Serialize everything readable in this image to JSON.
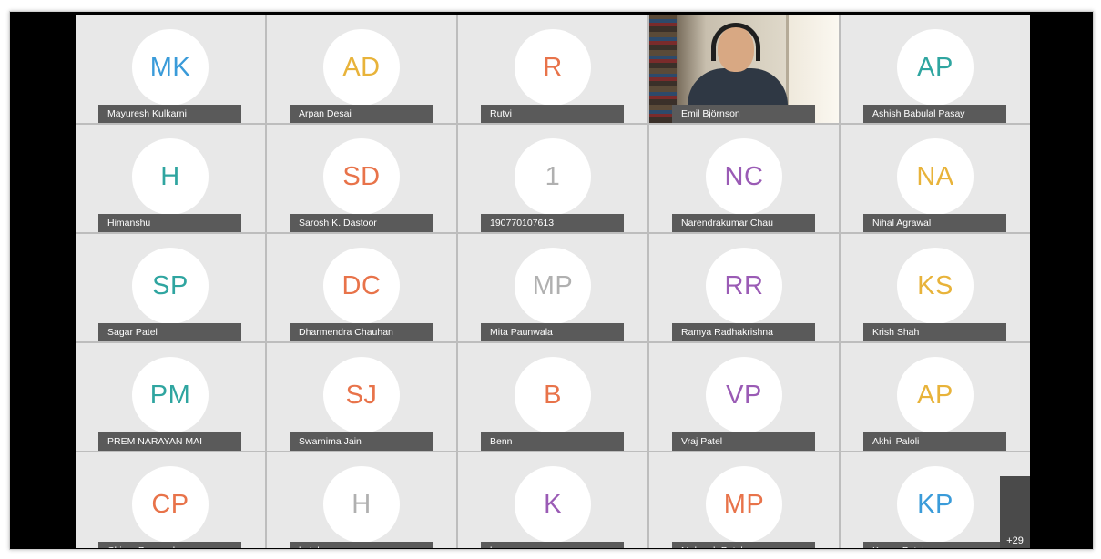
{
  "participants": [
    {
      "initials": "MK",
      "name": "Mayuresh Kulkarni",
      "color": "#3a9bd9"
    },
    {
      "initials": "AD",
      "name": "Arpan Desai",
      "color": "#e8b33a"
    },
    {
      "initials": "R",
      "name": "Rutvi",
      "color": "#e8734a"
    },
    {
      "initials": "",
      "name": "Emil Björnson",
      "color": "#ffffff",
      "video": true
    },
    {
      "initials": "AP",
      "name": "Ashish Babulal Pasay",
      "color": "#2fa5a0"
    },
    {
      "initials": "H",
      "name": "Himanshu",
      "color": "#2fa5a0"
    },
    {
      "initials": "SD",
      "name": "Sarosh K. Dastoor",
      "color": "#e8734a"
    },
    {
      "initials": "1",
      "name": "190770107613",
      "color": "#b0b0b0"
    },
    {
      "initials": "NC",
      "name": "Narendrakumar Chau",
      "color": "#9a5bb5"
    },
    {
      "initials": "NA",
      "name": "Nihal Agrawal",
      "color": "#e8b33a"
    },
    {
      "initials": "SP",
      "name": "Sagar Patel",
      "color": "#2fa5a0"
    },
    {
      "initials": "DC",
      "name": "Dharmendra Chauhan",
      "color": "#e8734a"
    },
    {
      "initials": "MP",
      "name": "Mita Paunwala",
      "color": "#b0b0b0"
    },
    {
      "initials": "RR",
      "name": "Ramya Radhakrishna",
      "color": "#9a5bb5"
    },
    {
      "initials": "KS",
      "name": "Krish Shah",
      "color": "#e8b33a"
    },
    {
      "initials": "PM",
      "name": "PREM NARAYAN MAI",
      "color": "#2fa5a0"
    },
    {
      "initials": "SJ",
      "name": "Swarnima Jain",
      "color": "#e8734a"
    },
    {
      "initials": "B",
      "name": "Benn",
      "color": "#e8734a"
    },
    {
      "initials": "VP",
      "name": "Vraj Patel",
      "color": "#9a5bb5"
    },
    {
      "initials": "AP",
      "name": "Akhil Paloli",
      "color": "#e8b33a"
    },
    {
      "initials": "CP",
      "name": "Chirag Paunwala",
      "color": "#e8734a"
    },
    {
      "initials": "H",
      "name": "hetal",
      "color": "#b0b0b0"
    },
    {
      "initials": "K",
      "name": "karan",
      "color": "#9a5bb5"
    },
    {
      "initials": "MP",
      "name": "Maharsh Patel",
      "color": "#e8734a"
    },
    {
      "initials": "KP",
      "name": "Kavan Patel",
      "color": "#3a9bd9"
    }
  ],
  "more_participants_label": "+29"
}
